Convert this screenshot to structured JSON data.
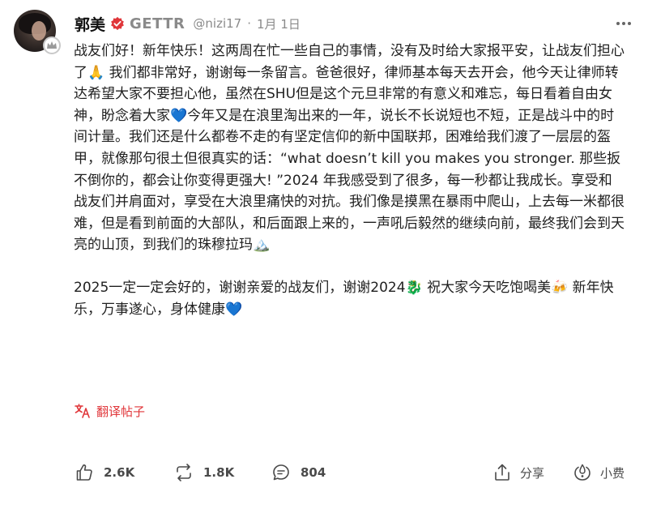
{
  "author": {
    "name": "郭美",
    "platform": "GETTR",
    "handle": "@nizi17",
    "separator": "·",
    "date": "1月 1日"
  },
  "post": {
    "paragraph1": "战友们好！新年快乐！这两周在忙一些自己的事情，没有及时给大家报平安，让战友们担心了🙏 我们都非常好，谢谢每一条留言。爸爸很好，律师基本每天去开会，他今天让律师转达希望大家不要担心他，虽然在SHU但是这个元旦非常的有意义和难忘，每日看着自由女神，盼念着大家💙今年又是在浪里淘出来的一年，说长不长说短也不短，正是战斗中的时间计量。我们还是什么都卷不走的有坚定信仰的新中国联邦，困难给我们渡了一层层的盔甲，就像那句很土但很真实的话：“what doesn’t kill you makes you stronger. 那些扳不倒你的，都会让你变得更强大! ”2024 年我感受到了很多，每一秒都让我成长。享受和战友们并肩面对，享受在大浪里痛快的对抗。我们像是摸黑在暴雨中爬山，上去每一米都很难，但是看到前面的大部队，和后面跟上来的，一声吼后毅然的继续向前，最终我们会到天亮的山顶，到我们的珠穆拉玛🏔️",
    "paragraph2": "2025一定一定会好的，谢谢亲爱的战友们，谢谢2024🐉 祝大家今天吃饱喝美🍻 新年快乐，万事遂心，身体健康💙"
  },
  "translate": {
    "label": "翻译帖子",
    "icon": "translate-icon"
  },
  "actions": {
    "like": {
      "count": "2.6K",
      "icon": "thumbs-up-icon"
    },
    "repost": {
      "count": "1.8K",
      "icon": "repost-icon"
    },
    "comment": {
      "count": "804",
      "icon": "comment-icon"
    },
    "share": {
      "label": "分享",
      "icon": "share-icon"
    },
    "tip": {
      "label": "小费",
      "icon": "tip-icon"
    }
  },
  "colors": {
    "verified": "#e0363a",
    "translate": "#e0363a",
    "muted": "#8a8a8a",
    "text": "#1f1f1f"
  }
}
